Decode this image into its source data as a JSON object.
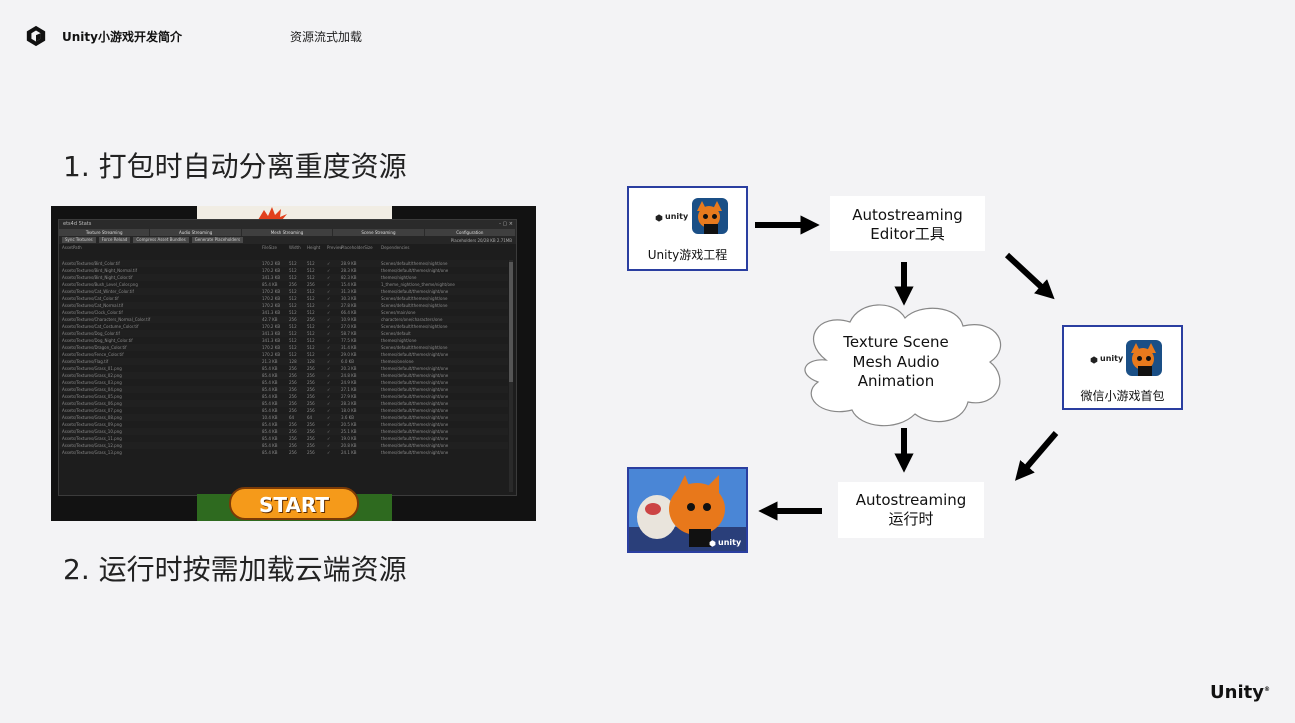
{
  "header": {
    "title": "Unity小游戏开发简介",
    "section": "资源流式加载"
  },
  "steps": {
    "step1": "1. 打包时自动分离重度资源",
    "step2": "2. 运行时按需加载云端资源"
  },
  "editor": {
    "window_title": "ets4d Stats",
    "controls": "- ▢ ×",
    "tabs": [
      "Texture Streaming",
      "Audio Streaming",
      "Mesh Streaming",
      "Scene Streaming",
      "Configuration"
    ],
    "subbar": [
      "Sync Textures",
      "Force Reload",
      "Compress Asset Bundles",
      "Generate Placeholders"
    ],
    "info": "Placeholders 20/28 KB 2.71MB",
    "columns": [
      "AssetPath",
      "FileSize",
      "Width",
      "Height",
      "Preview",
      "PlaceholderSize",
      "Dependencies"
    ],
    "rows": [
      {
        "path": "Assets/Textures/Bird_Color.tif",
        "size": "170.2 KB",
        "w": "512",
        "h": "512",
        "kb": "28.9 KB",
        "dir": "Scenes/default/themes/night/one"
      },
      {
        "path": "Assets/Textures/Bird_Night_Normal.tif",
        "size": "170.2 KB",
        "w": "512",
        "h": "512",
        "kb": "28.3 KB",
        "dir": "themes/default/themes/night/one"
      },
      {
        "path": "Assets/Textures/Bird_Night_Color.tif",
        "size": "341.3 KB",
        "w": "512",
        "h": "512",
        "kb": "82.3 KB",
        "dir": "themes/night/one"
      },
      {
        "path": "Assets/Textures/Bush_Level_Color.png",
        "size": "85.4 KB",
        "w": "256",
        "h": "256",
        "kb": "15.4 KB",
        "dir": "1_theme_night/one_theme/night/one"
      },
      {
        "path": "Assets/Textures/Cat_Winter_Color.tif",
        "size": "170.2 KB",
        "w": "512",
        "h": "512",
        "kb": "31.3 KB",
        "dir": "themes/default/themes/night/one"
      },
      {
        "path": "Assets/Textures/Cat_Color.tif",
        "size": "170.2 KB",
        "w": "512",
        "h": "512",
        "kb": "30.3 KB",
        "dir": "Scenes/default/themes/night/one"
      },
      {
        "path": "Assets/Textures/Cat_Normal.tif",
        "size": "170.2 KB",
        "w": "512",
        "h": "512",
        "kb": "27.8 KB",
        "dir": "Scenes/default/themes/night/one"
      },
      {
        "path": "Assets/Textures/Clock_Color.tif",
        "size": "341.3 KB",
        "w": "512",
        "h": "512",
        "kb": "66.4 KB",
        "dir": "Scenes/main/one"
      },
      {
        "path": "Assets/Textures/Characters_Normal_Color.tif",
        "size": "42.7 KB",
        "w": "256",
        "h": "256",
        "kb": "10.9 KB",
        "dir": "characters/one/characters/one"
      },
      {
        "path": "Assets/Textures/Cat_Costume_Color.tif",
        "size": "170.2 KB",
        "w": "512",
        "h": "512",
        "kb": "27.0 KB",
        "dir": "Scenes/default/themes/night/one"
      },
      {
        "path": "Assets/Textures/Dog_Color.tif",
        "size": "341.3 KB",
        "w": "512",
        "h": "512",
        "kb": "58.7 KB",
        "dir": "Scenes/default"
      },
      {
        "path": "Assets/Textures/Dog_Night_Color.tif",
        "size": "341.3 KB",
        "w": "512",
        "h": "512",
        "kb": "77.5 KB",
        "dir": "themes/night/one"
      },
      {
        "path": "Assets/Textures/Dragon_Color.tif",
        "size": "170.2 KB",
        "w": "512",
        "h": "512",
        "kb": "31.4 KB",
        "dir": "Scenes/default/themes/night/one"
      },
      {
        "path": "Assets/Textures/Fence_Color.tif",
        "size": "170.2 KB",
        "w": "512",
        "h": "512",
        "kb": "29.0 KB",
        "dir": "themes/default/themes/night/one"
      },
      {
        "path": "Assets/Textures/Flag.tif",
        "size": "21.3 KB",
        "w": "128",
        "h": "128",
        "kb": "6.0 KB",
        "dir": "themes/one/one"
      },
      {
        "path": "Assets/Textures/Grass_01.png",
        "size": "85.4 KB",
        "w": "256",
        "h": "256",
        "kb": "20.3 KB",
        "dir": "themes/default/themes/night/one"
      },
      {
        "path": "Assets/Textures/Grass_02.png",
        "size": "85.4 KB",
        "w": "256",
        "h": "256",
        "kb": "24.8 KB",
        "dir": "themes/default/themes/night/one"
      },
      {
        "path": "Assets/Textures/Grass_03.png",
        "size": "85.4 KB",
        "w": "256",
        "h": "256",
        "kb": "24.9 KB",
        "dir": "themes/default/themes/night/one"
      },
      {
        "path": "Assets/Textures/Grass_04.png",
        "size": "85.4 KB",
        "w": "256",
        "h": "256",
        "kb": "27.1 KB",
        "dir": "themes/default/themes/night/one"
      },
      {
        "path": "Assets/Textures/Grass_05.png",
        "size": "85.4 KB",
        "w": "256",
        "h": "256",
        "kb": "27.9 KB",
        "dir": "themes/default/themes/night/one"
      },
      {
        "path": "Assets/Textures/Grass_06.png",
        "size": "85.4 KB",
        "w": "256",
        "h": "256",
        "kb": "28.3 KB",
        "dir": "themes/default/themes/night/one"
      },
      {
        "path": "Assets/Textures/Grass_07.png",
        "size": "85.4 KB",
        "w": "256",
        "h": "256",
        "kb": "18.0 KB",
        "dir": "themes/default/themes/night/one"
      },
      {
        "path": "Assets/Textures/Grass_08.png",
        "size": "10.4 KB",
        "w": "64",
        "h": "64",
        "kb": "3.6 KB",
        "dir": "themes/default/themes/night/one"
      },
      {
        "path": "Assets/Textures/Grass_09.png",
        "size": "85.4 KB",
        "w": "256",
        "h": "256",
        "kb": "20.5 KB",
        "dir": "themes/default/themes/night/one"
      },
      {
        "path": "Assets/Textures/Grass_10.png",
        "size": "85.4 KB",
        "w": "256",
        "h": "256",
        "kb": "25.1 KB",
        "dir": "themes/default/themes/night/one"
      },
      {
        "path": "Assets/Textures/Grass_11.png",
        "size": "85.4 KB",
        "w": "256",
        "h": "256",
        "kb": "19.0 KB",
        "dir": "themes/default/themes/night/one"
      },
      {
        "path": "Assets/Textures/Grass_12.png",
        "size": "85.4 KB",
        "w": "256",
        "h": "256",
        "kb": "20.8 KB",
        "dir": "themes/default/themes/night/one"
      },
      {
        "path": "Assets/Textures/Grass_13.png",
        "size": "85.4 KB",
        "w": "256",
        "h": "256",
        "kb": "24.1 KB",
        "dir": "themes/default/themes/night/one"
      }
    ],
    "start_label": "START"
  },
  "diagram": {
    "unity_project": {
      "logo_text": "unity",
      "label": "Unity游戏工程"
    },
    "editor_tool": {
      "line1": "Autostreaming",
      "line2": "Editor工具"
    },
    "cloud": {
      "line1": "Texture Scene",
      "line2": "Mesh  Audio",
      "line3": "Animation"
    },
    "wechat_package": {
      "logo_text": "unity",
      "label": "微信小游戏首包"
    },
    "runtime": {
      "line1": "Autostreaming",
      "line2": "运行时"
    },
    "game_shot": {
      "logo_text": "unity"
    }
  },
  "footer": {
    "brand": "Unity"
  },
  "colors": {
    "accent_blue": "#2a3ea0",
    "background": "#f3f3f5",
    "start_orange": "#f59a1a"
  }
}
